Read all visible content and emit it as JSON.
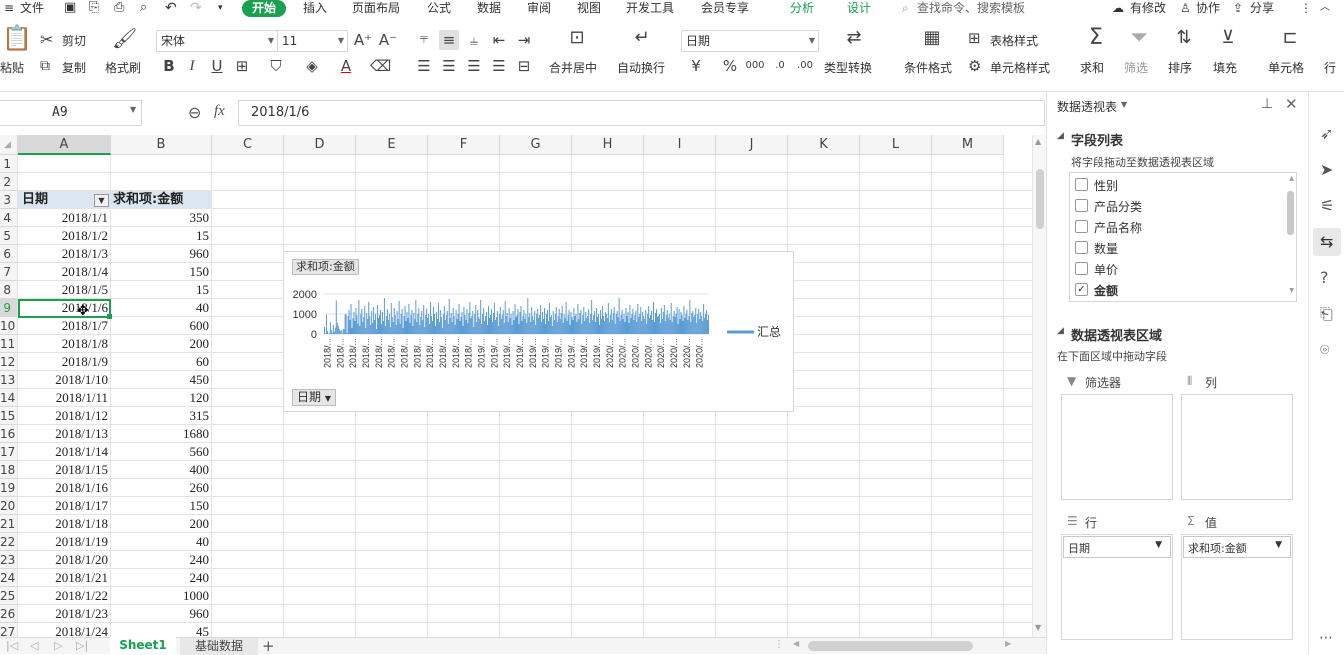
{
  "menu": {
    "file": "文件",
    "tabs": [
      "开始",
      "插入",
      "页面布局",
      "公式",
      "数据",
      "审阅",
      "视图",
      "开发工具",
      "会员专享"
    ],
    "active_tab": "开始",
    "context_tabs": [
      "分析",
      "设计"
    ],
    "search_placeholder": "查找命令、搜索模板",
    "modified": "有修改",
    "collaborate": "协作",
    "share": "分享"
  },
  "ribbon": {
    "paste": "粘贴",
    "cut": "剪切",
    "copy": "复制",
    "format_painter": "格式刷",
    "font_name": "宋体",
    "font_size": "11",
    "merge_center": "合并居中",
    "wrap_text": "自动换行",
    "number_format": "日期",
    "currency": "¥",
    "percent": "%",
    "type_convert": "类型转换",
    "cond_format": "条件格式",
    "table_style": "表格样式",
    "cell_style": "单元格样式",
    "sum": "求和",
    "filter": "筛选",
    "sort": "排序",
    "fill": "填充",
    "cells": "单元格",
    "row_col": "行"
  },
  "formula_bar": {
    "name_box": "A9",
    "fx": "fx",
    "value": "2018/1/6"
  },
  "columns": [
    "A",
    "B",
    "C",
    "D",
    "E",
    "F",
    "G",
    "H",
    "I",
    "J",
    "K",
    "L",
    "M"
  ],
  "rows": [
    "1",
    "2",
    "3",
    "4",
    "5",
    "6",
    "7",
    "8",
    "9",
    "10",
    "11",
    "12",
    "13",
    "14",
    "15",
    "16",
    "17",
    "18",
    "19",
    "20",
    "21",
    "22",
    "23",
    "24",
    "25",
    "26",
    "27"
  ],
  "pivot": {
    "header_date": "日期",
    "header_sum": "求和项:金额",
    "dates": [
      "2018/1/1",
      "2018/1/2",
      "2018/1/3",
      "2018/1/4",
      "2018/1/5",
      "2018/1/6",
      "2018/1/7",
      "2018/1/8",
      "2018/1/9",
      "2018/1/10",
      "2018/1/11",
      "2018/1/12",
      "2018/1/13",
      "2018/1/14",
      "2018/1/15",
      "2018/1/16",
      "2018/1/17",
      "2018/1/18",
      "2018/1/19",
      "2018/1/20",
      "2018/1/21",
      "2018/1/22",
      "2018/1/23",
      "2018/1/24"
    ],
    "amounts": [
      "350",
      "15",
      "960",
      "150",
      "15",
      "40",
      "600",
      "200",
      "60",
      "450",
      "120",
      "315",
      "1680",
      "560",
      "400",
      "260",
      "150",
      "200",
      "40",
      "240",
      "240",
      "1000",
      "960",
      "45"
    ]
  },
  "chart_data": {
    "type": "bar",
    "title": "",
    "field_button": "求和项:金额",
    "axis_button": "日期",
    "legend": "汇总",
    "yticks": [
      "2000",
      "1000",
      "0"
    ],
    "ylim": [
      0,
      2000
    ],
    "xtick_labels": [
      "2018/...",
      "2018/...",
      "2018/...",
      "2018/...",
      "2018/...",
      "2018/...",
      "2018/...",
      "2018/...",
      "2018/...",
      "2018/...",
      "2018/...",
      "2018/...",
      "2019/...",
      "2019/...",
      "2019/...",
      "2019/...",
      "2019/...",
      "2019/...",
      "2019/...",
      "2019/...",
      "2019/...",
      "2019/...",
      "2020/...",
      "2020/...",
      "2020/...",
      "2020/...",
      "2020/...",
      "2020/...",
      "2020/...",
      "2020/..."
    ],
    "values": [
      350,
      15,
      960,
      150,
      15,
      40,
      600,
      200,
      60,
      450,
      120,
      315,
      1680,
      560,
      400,
      260,
      150,
      200,
      40,
      240,
      240,
      1000,
      960,
      45,
      900,
      1200,
      700,
      1500,
      300,
      800,
      1100,
      650,
      1300,
      950,
      500,
      1700,
      400,
      1000,
      1250,
      600,
      850,
      1400,
      300,
      1050,
      750,
      1600,
      900,
      450,
      1150,
      550,
      1350,
      700,
      1000,
      250,
      1450,
      800,
      950,
      1200,
      500,
      1100,
      650,
      1800,
      400,
      900,
      1250,
      700,
      1000,
      350,
      1550,
      850,
      600,
      1300,
      950,
      450,
      1150,
      750,
      1650,
      500,
      1000,
      1250,
      300,
      900,
      1400,
      650,
      1100,
      800,
      1500,
      550,
      950,
      1200,
      400,
      1050,
      750,
      1700,
      600,
      1000,
      1300,
      450,
      850,
      1150,
      700,
      1450,
      350,
      950,
      1250,
      800,
      1000,
      500,
      1600,
      900,
      650,
      1350,
      1000,
      400,
      1100,
      750,
      1550,
      600,
      1200,
      850,
      300,
      1000,
      1400,
      700,
      950,
      1150,
      500,
      1750,
      800,
      1050,
      600,
      1300,
      900,
      450,
      1200,
      750,
      1000,
      1500,
      650,
      850,
      1100,
      400,
      1350,
      950,
      700,
      1250,
      550,
      1050,
      1600,
      800,
      900,
      1150,
      350,
      1000,
      1450,
      600,
      1200,
      850,
      750,
      1700,
      500,
      1000,
      1300,
      650,
      900,
      1100,
      450,
      1400,
      800,
      950,
      1250,
      600,
      1050,
      1550,
      700,
      850,
      1150,
      400,
      1000,
      1350,
      750,
      950,
      1200,
      550,
      1650,
      900,
      1050,
      600,
      1300,
      800,
      1000,
      450,
      1150,
      700,
      1500,
      850,
      950,
      1250,
      500,
      1100,
      1400,
      650,
      900,
      1200,
      750,
      1000,
      550,
      1800,
      850,
      1050,
      600,
      1350,
      900,
      700,
      1150,
      450,
      1000,
      1250,
      800,
      950,
      1450,
      600,
      1100,
      750,
      1300,
      500,
      1000,
      1200,
      650,
      1550,
      850,
      950,
      400,
      1150,
      700,
      1000,
      1350,
      600,
      900,
      1250,
      750,
      1050,
      1400,
      550,
      1000,
      800,
      1600,
      650,
      950,
      1200,
      450,
      1100,
      850,
      700,
      1300,
      900,
      1000,
      600,
      1500,
      750,
      1050,
      1200,
      500,
      950,
      1350,
      650,
      1100,
      800,
      900,
      1250,
      550,
      1000,
      1700,
      700,
      950,
      1150,
      600,
      1300,
      850,
      1000,
      450,
      1200,
      750,
      1400,
      900,
      650,
      1100,
      1000,
      800,
      1550,
      600,
      950,
      1250,
      700,
      1050,
      1350,
      500,
      1000,
      1150,
      850,
      1800,
      650,
      950,
      1200,
      750,
      1000,
      600,
      1300,
      900,
      1100,
      550,
      1450,
      800,
      1000,
      1250,
      700,
      950,
      1150,
      600,
      1500,
      850,
      1000,
      1350,
      650,
      1100,
      900,
      750,
      1200,
      500,
      1000,
      1400,
      800,
      950,
      1150,
      700,
      1600,
      600,
      1050,
      1250,
      850,
      900,
      1000,
      550,
      1300,
      750,
      1100,
      1450,
      650,
      950,
      1200,
      800,
      1000,
      700,
      1550,
      600,
      900,
      1150,
      850,
      1000,
      1350,
      500,
      1250,
      750,
      1100,
      950,
      650,
      1400,
      800,
      1000,
      1200,
      700,
      900,
      1700,
      600,
      1050,
      1150,
      850,
      950,
      1300,
      550,
      1000,
      1250,
      750,
      1100,
      900,
      650,
      1500,
      800,
      1000,
      1200,
      700,
      950
    ]
  },
  "sheets": {
    "active": "Sheet1",
    "other": "基础数据",
    "add": "+"
  },
  "panel": {
    "title": "数据透视表",
    "field_list": "字段列表",
    "field_hint": "将字段拖动至数据透视表区域",
    "fields": [
      {
        "name": "性别",
        "checked": false
      },
      {
        "name": "产品分类",
        "checked": false
      },
      {
        "name": "产品名称",
        "checked": false
      },
      {
        "name": "数量",
        "checked": false
      },
      {
        "name": "单价",
        "checked": false
      },
      {
        "name": "金额",
        "checked": true
      }
    ],
    "area_title": "数据透视表区域",
    "area_hint": "在下面区域中拖动字段",
    "filter_label": "筛选器",
    "col_label": "列",
    "row_label": "行",
    "value_label": "值",
    "row_field": "日期",
    "value_field": "求和项:金额"
  },
  "colors": {
    "accent": "#1aa150",
    "bar": "#5b9bd5"
  }
}
